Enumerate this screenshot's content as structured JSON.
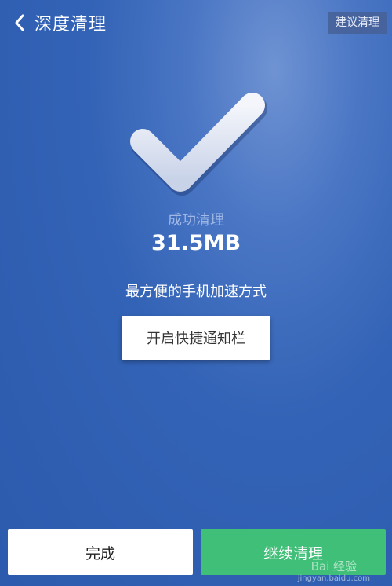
{
  "header": {
    "title": "深度清理",
    "back_icon": "chevron-left-icon",
    "suggest_label": "建议清理"
  },
  "result": {
    "status_icon": "checkmark-icon",
    "success_label": "成功清理",
    "size": "31.5MB",
    "tagline": "最方便的手机加速方式",
    "notify_button": "开启快捷通知栏"
  },
  "footer": {
    "done_label": "完成",
    "continue_label": "继续清理"
  },
  "watermark": {
    "main": "Bai 经验",
    "sub": "jingyan.baidu.com"
  },
  "colors": {
    "background": "#3363b6",
    "continue_button": "#3fbf77",
    "suggest_button": "#466096"
  }
}
